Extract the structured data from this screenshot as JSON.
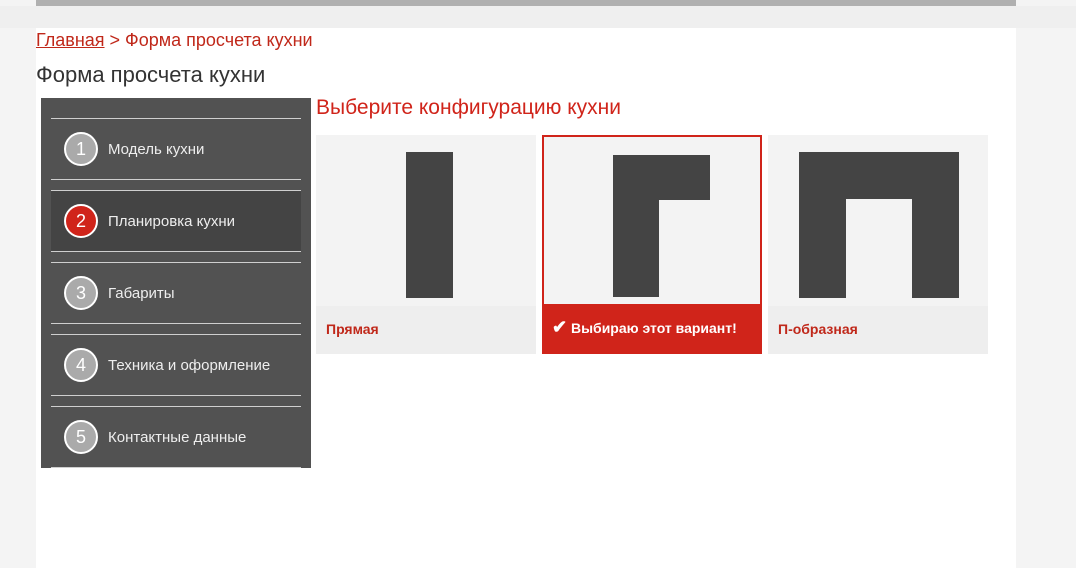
{
  "breadcrumb": {
    "home": "Главная",
    "separator": " > ",
    "current": "Форма просчета кухни"
  },
  "title": "Форма просчета кухни",
  "steps": [
    {
      "num": "1",
      "label": "Модель кухни"
    },
    {
      "num": "2",
      "label": "Планировка кухни"
    },
    {
      "num": "3",
      "label": "Габариты"
    },
    {
      "num": "4",
      "label": "Техника и оформление"
    },
    {
      "num": "5",
      "label": "Контактные данные"
    }
  ],
  "subtitle": "Выберите конфигурацию кухни",
  "options": [
    {
      "label": "Прямая"
    },
    {
      "label": "Выбираю этот вариант!"
    },
    {
      "label": "П-образная"
    }
  ],
  "colors": {
    "accent": "#d0241a",
    "sidebar": "#525252"
  }
}
